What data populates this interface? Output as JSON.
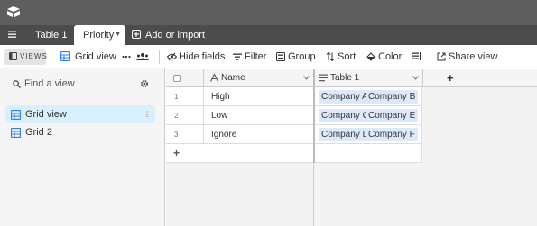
{
  "app": {
    "logo": "airtable-logo-icon"
  },
  "tabs": {
    "menu_icon": "hamburger-icon",
    "table1": "Table 1",
    "active": "Priority",
    "add_import": "Add or import"
  },
  "toolbar": {
    "views": "VIEWS",
    "view_name": "Grid view",
    "hide_fields": "Hide fields",
    "filter": "Filter",
    "group": "Group",
    "sort": "Sort",
    "color": "Color",
    "share_view": "Share view"
  },
  "sidebar": {
    "search_placeholder": "Find a view",
    "items": [
      {
        "label": "Grid view",
        "active": true
      },
      {
        "label": "Grid 2",
        "active": false
      }
    ]
  },
  "grid": {
    "columns": [
      "Name",
      "Table 1"
    ],
    "rows": [
      {
        "num": "1",
        "name": "High",
        "links": [
          "Company A",
          "Company B"
        ]
      },
      {
        "num": "2",
        "name": "Low",
        "links": [
          "Company C",
          "Company E"
        ]
      },
      {
        "num": "3",
        "name": "Ignore",
        "links": [
          "Company D",
          "Company F"
        ]
      }
    ],
    "add_column": "+",
    "add_row": "+"
  },
  "colors": {
    "topbar": "#5e5e5e",
    "tabbar": "#4c4c4c",
    "active_view": "#d8f0fb",
    "chip": "#dce9f8",
    "grid_icon": "#2d7ff9"
  }
}
